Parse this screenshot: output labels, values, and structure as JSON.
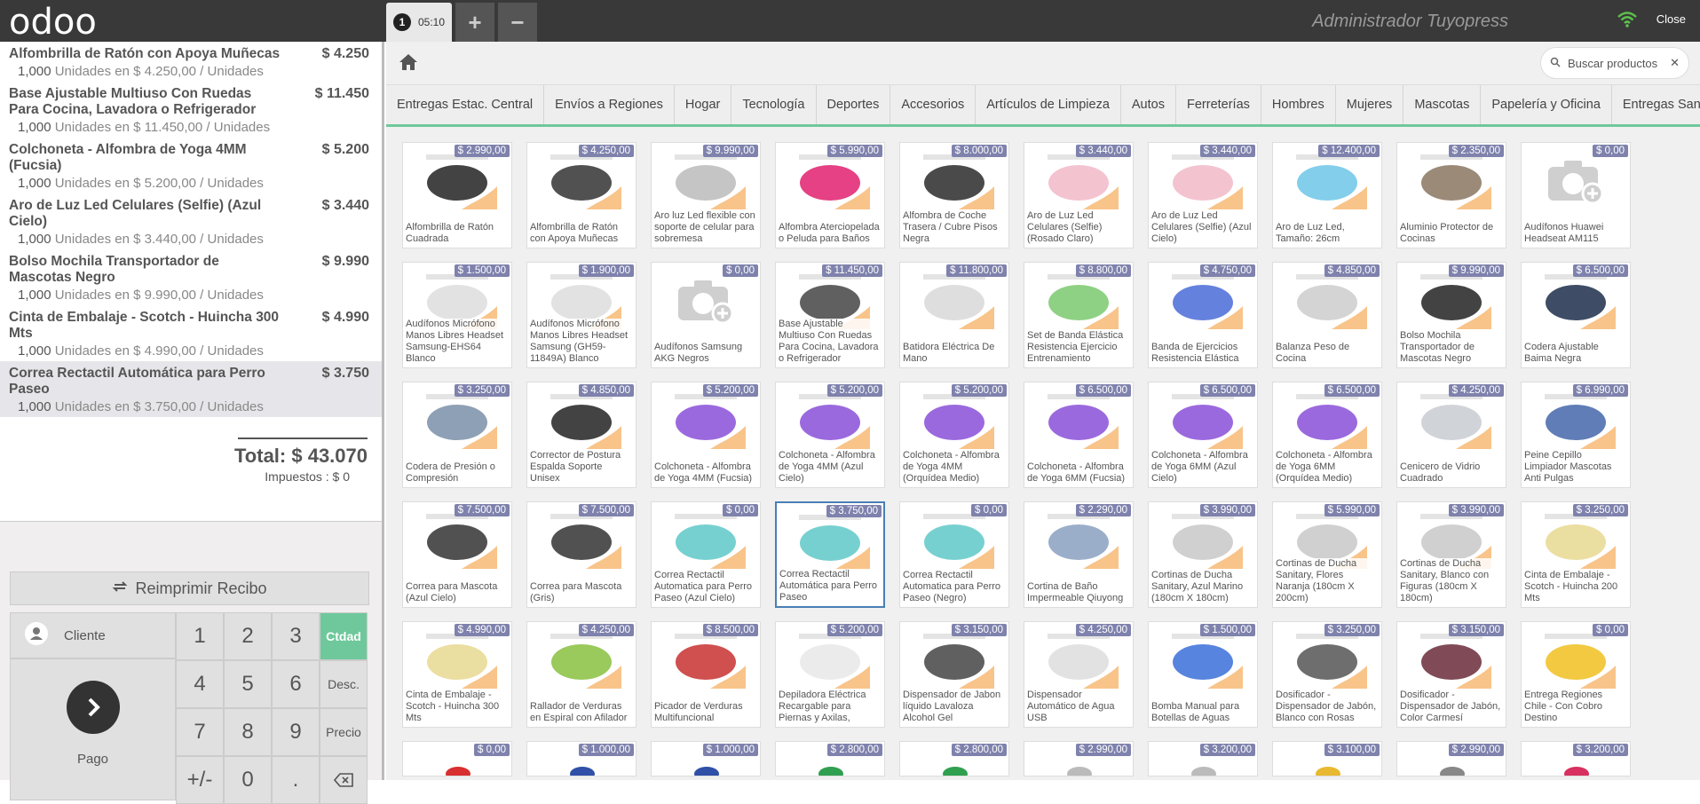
{
  "topbar": {
    "logo": "odoo",
    "order_number": "1",
    "order_time": "05:10",
    "add_label": "+",
    "remove_label": "−",
    "user": "Administrador Tuyopress",
    "close": "Close"
  },
  "order_lines": [
    {
      "name": "Alfombrilla de Ratón con Apoya Muñecas",
      "price": "$ 4.250",
      "qty": "1,000",
      "unit_info": "Unidades en $ 4.250,00 / Unidades"
    },
    {
      "name": "Base Ajustable Multiuso Con Ruedas Para Cocina, Lavadora o Refrigerador",
      "price": "$ 11.450",
      "qty": "1,000",
      "unit_info": "Unidades en $ 11.450,00 / Unidades"
    },
    {
      "name": "Colchoneta - Alfombra de Yoga 4MM (Fucsia)",
      "price": "$ 5.200",
      "qty": "1,000",
      "unit_info": "Unidades en $ 5.200,00 / Unidades"
    },
    {
      "name": "Aro de Luz Led Celulares (Selfie) (Azul Cielo)",
      "price": "$ 3.440",
      "qty": "1,000",
      "unit_info": "Unidades en $ 3.440,00 / Unidades"
    },
    {
      "name": "Bolso Mochila Transportador de Mascotas Negro",
      "price": "$ 9.990",
      "qty": "1,000",
      "unit_info": "Unidades en $ 9.990,00 / Unidades"
    },
    {
      "name": "Cinta de Embalaje - Scotch - Huincha 300 Mts",
      "price": "$ 4.990",
      "qty": "1,000",
      "unit_info": "Unidades en $ 4.990,00 / Unidades"
    },
    {
      "name": "Correa Rectactil Automática para Perro Paseo",
      "price": "$ 3.750",
      "qty": "1,000",
      "unit_info": "Unidades en $ 3.750,00 / Unidades"
    }
  ],
  "totals": {
    "total": "Total: $ 43.070",
    "taxes": "Impuestos : $ 0"
  },
  "pad": {
    "reprint": "Reimprimir Recibo",
    "customer": "Cliente",
    "payment": "Pago",
    "keys": [
      "1",
      "2",
      "3",
      "Ctdad",
      "4",
      "5",
      "6",
      "Desc.",
      "7",
      "8",
      "9",
      "Precio",
      "+/-",
      "0",
      "."
    ],
    "active_mode": "Ctdad"
  },
  "search": {
    "placeholder": "Buscar productos"
  },
  "categories": [
    "Entregas Estac. Central",
    "Envíos a Regiones",
    "Hogar",
    "Tecnología",
    "Deportes",
    "Accesorios",
    "Artículos de Limpieza",
    "Autos",
    "Ferreterías",
    "Hombres",
    "Mujeres",
    "Mascotas",
    "Papelería y Oficina",
    "Entregas San Miguel"
  ],
  "products": [
    {
      "name": "Alfombrilla de Ratón Cuadrada",
      "price": "$ 2.990,00",
      "color": "#222222"
    },
    {
      "name": "Alfombrilla de Ratón con Apoya Muñecas",
      "price": "$ 4.250,00",
      "color": "#333333"
    },
    {
      "name": "Aro luz Led flexible con soporte de celular para sobremesa",
      "price": "$ 9.990,00",
      "color": "#bbbbbb"
    },
    {
      "name": "Alfombra Aterciopelada o Peluda para Baños",
      "price": "$ 5.990,00",
      "color": "#e0206e"
    },
    {
      "name": "Alfombra de Coche Trasera / Cubre Pisos Negra",
      "price": "$ 8.000,00",
      "color": "#2a2a2a"
    },
    {
      "name": "Aro de Luz Led Celulares (Selfie) (Rosado Claro)",
      "price": "$ 3.440,00",
      "color": "#f2b8c8"
    },
    {
      "name": "Aro de Luz Led Celulares (Selfie) (Azul Cielo)",
      "price": "$ 3.440,00",
      "color": "#f2b8c8"
    },
    {
      "name": "Aro de Luz Led, Tamaño: 26cm",
      "price": "$ 12.400,00",
      "color": "#6cc6e8"
    },
    {
      "name": "Aluminio Protector de Cocinas",
      "price": "$ 2.350,00",
      "color": "#8a7560"
    },
    {
      "name": "Audífonos Huawei Headseat AM115",
      "price": "$ 0,00",
      "color": "placeholder"
    },
    {
      "name": "Audífonos Micrófono Manos Libres Headset Samsung-EHS64 Blanco",
      "price": "$ 1.500,00",
      "color": "#dddddd"
    },
    {
      "name": "Audífonos Micrófono Manos Libres Headset Samsung (GH59-11849A) Blanco",
      "price": "$ 1.900,00",
      "color": "#dddddd"
    },
    {
      "name": "Audífonos Samsung AKG Negros",
      "price": "$ 0,00",
      "color": "placeholder"
    },
    {
      "name": "Base Ajustable Multiuso Con Ruedas Para Cocina, Lavadora o Refrigerador",
      "price": "$ 11.450,00",
      "color": "#444444"
    },
    {
      "name": "Batidora Eléctrica De Mano",
      "price": "$ 11.800,00",
      "color": "#d8d8d8"
    },
    {
      "name": "Set de Banda Elástica Resistencia Ejercicio Entrenamiento",
      "price": "$ 8.800,00",
      "color": "#7bc96f"
    },
    {
      "name": "Banda de Ejercicios Resistencia Elástica",
      "price": "$ 4.750,00",
      "color": "#4a6bd8"
    },
    {
      "name": "Balanza Peso de Cocina",
      "price": "$ 4.850,00",
      "color": "#cccccc"
    },
    {
      "name": "Bolso Mochila Transportador de Mascotas Negro",
      "price": "$ 9.990,00",
      "color": "#222222"
    },
    {
      "name": "Codera Ajustable Baima Negra",
      "price": "$ 6.500,00",
      "color": "#1c2e4a"
    },
    {
      "name": "Codera de Presión o Compresión",
      "price": "$ 3.250,00",
      "color": "#7a8fa8"
    },
    {
      "name": "Corrector de Postura Espalda Soporte Unisex",
      "price": "$ 4.850,00",
      "color": "#222222"
    },
    {
      "name": "Colchoneta - Alfombra de Yoga 4MM (Fucsia)",
      "price": "$ 5.200,00",
      "color": "#8a4fd8"
    },
    {
      "name": "Colchoneta - Alfombra de Yoga 4MM (Azul Cielo)",
      "price": "$ 5.200,00",
      "color": "#8a4fd8"
    },
    {
      "name": "Colchoneta - Alfombra de Yoga 4MM (Orquídea Medio)",
      "price": "$ 5.200,00",
      "color": "#8a4fd8"
    },
    {
      "name": "Colchoneta - Alfombra de Yoga 6MM (Fucsia)",
      "price": "$ 6.500,00",
      "color": "#8a4fd8"
    },
    {
      "name": "Colchoneta - Alfombra de Yoga 6MM (Azul Cielo)",
      "price": "$ 6.500,00",
      "color": "#8a4fd8"
    },
    {
      "name": "Colchoneta - Alfombra de Yoga 6MM (Orquídea Medio)",
      "price": "$ 6.500,00",
      "color": "#8a4fd8"
    },
    {
      "name": "Cenicero de Vidrio Cuadrado",
      "price": "$ 4.250,00",
      "color": "#c8ccd2"
    },
    {
      "name": "Peine Cepillo Limpiador Mascotas Anti Pulgas",
      "price": "$ 6.990,00",
      "color": "#4466aa"
    },
    {
      "name": "Correa para Mascota (Azul Cielo)",
      "price": "$ 7.500,00",
      "color": "#333333"
    },
    {
      "name": "Correa para Mascota (Gris)",
      "price": "$ 7.500,00",
      "color": "#333333"
    },
    {
      "name": "Correa Rectactil Automatica para Perro Paseo (Azul Cielo)",
      "price": "$ 0,00",
      "color": "#5fc8c8"
    },
    {
      "name": "Correa Rectactil Automática para Perro Paseo",
      "price": "$ 3.750,00",
      "color": "#5fc8c8"
    },
    {
      "name": "Correa Rectactil Automatica para Perro Paseo (Negro)",
      "price": "$ 0,00",
      "color": "#5fc8c8"
    },
    {
      "name": "Cortina de Baño Impermeable Qiuyong",
      "price": "$ 2.290,00",
      "color": "#8aa0c0"
    },
    {
      "name": "Cortinas de Ducha Sanitary, Azul Marino (180cm X 180cm)",
      "price": "$ 3.990,00",
      "color": "#c8c8c8"
    },
    {
      "name": "Cortinas de Ducha Sanitary, Flores Naranja (180cm X 200cm)",
      "price": "$ 5.990,00",
      "color": "#c8c8c8"
    },
    {
      "name": "Cortinas de Ducha Sanitary, Blanco con Figuras (180cm X 180cm)",
      "price": "$ 3.990,00",
      "color": "#c8c8c8"
    },
    {
      "name": "Cinta de Embalaje - Scotch - Huincha 200 Mts",
      "price": "$ 3.250,00",
      "color": "#e8d890"
    },
    {
      "name": "Cinta de Embalaje - Scotch - Huincha 300 Mts",
      "price": "$ 4.990,00",
      "color": "#e8d890"
    },
    {
      "name": "Rallador de Verduras en Espiral con Afilador",
      "price": "$ 4.250,00",
      "color": "#88c040"
    },
    {
      "name": "Picador de Verduras Multifuncional",
      "price": "$ 8.500,00",
      "color": "#c83030"
    },
    {
      "name": "Depiladora Eléctrica Recargable para Piernas y Axilas,",
      "price": "$ 5.200,00",
      "color": "#e8e8e8"
    },
    {
      "name": "Dispensador de Jabon líquido Lavaloza Alcohol Gel",
      "price": "$ 3.150,00",
      "color": "#444444"
    },
    {
      "name": "Dispensador Automático de Agua USB",
      "price": "$ 4.250,00",
      "color": "#dddddd"
    },
    {
      "name": "Bomba Manual para Botellas de Aguas",
      "price": "$ 1.500,00",
      "color": "#3a6fd8"
    },
    {
      "name": "Dosificador - Dispensador de Jabón, Blanco con Rosas",
      "price": "$ 3.250,00",
      "color": "#555555"
    },
    {
      "name": "Dosificador - Dispensador de Jabón, Color Carmesí",
      "price": "$ 3.150,00",
      "color": "#6a2a3a"
    },
    {
      "name": "Entrega Regiones Chile - Con Cobro Destino",
      "price": "$ 0,00",
      "color": "#f0c020"
    }
  ],
  "partial_products": [
    {
      "price": "$ 0,00",
      "color": "#d83030"
    },
    {
      "price": "$ 1.000,00",
      "color": "#3050a8"
    },
    {
      "price": "$ 1.000,00",
      "color": "#3050a8"
    },
    {
      "price": "$ 2.800,00",
      "color": "#30a050"
    },
    {
      "price": "$ 2.800,00",
      "color": "#30a050"
    },
    {
      "price": "$ 2.990,00",
      "color": "#bbbbbb"
    },
    {
      "price": "$ 3.200,00",
      "color": "#bbbbbb"
    },
    {
      "price": "$ 3.100,00",
      "color": "#e8b830"
    },
    {
      "price": "$ 2.990,00",
      "color": "#888888"
    },
    {
      "price": "$ 3.200,00",
      "color": "#d83060"
    }
  ],
  "selected_product_index": 33
}
